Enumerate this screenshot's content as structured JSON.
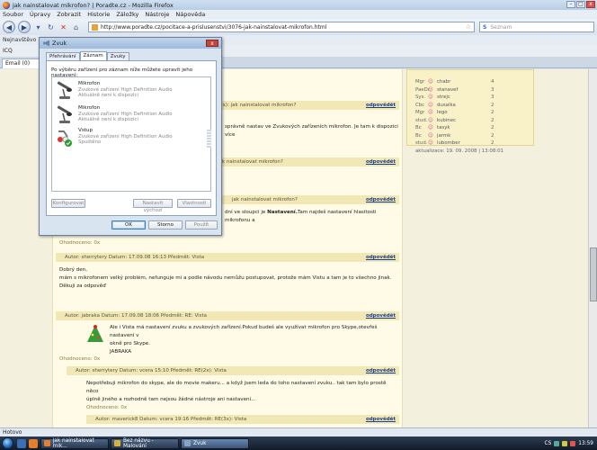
{
  "browser": {
    "title": "jak nainstalovat mikrofon? | Poradte.cz - Mozilla Firefox",
    "menu": [
      "Soubor",
      "Úpravy",
      "Zobrazit",
      "Historie",
      "Záložky",
      "Nástroje",
      "Nápověda"
    ],
    "url": "http://www.poradte.cz/pocitace-a-prislusenstvi/3076-jak-nainstalovat-mikrofon.html",
    "search_placeholder": "Seznam",
    "bookmark": "Nejnavštěvo",
    "toolbar_icq": "ICQ",
    "tab_label": "Email (0)",
    "status": "Hotovo"
  },
  "dialog": {
    "title": "Zvuk",
    "tabs": [
      "Přehrávání",
      "Záznam",
      "Zvuky"
    ],
    "active_tab": 1,
    "instruction": "Po výběru zařízení pro záznam níže můžete upravit jeho nastavení:",
    "devices": [
      {
        "name": "Mikrofon",
        "driver": "Zvukové zařízení High Definition Audio",
        "state": "Aktuálně není k dispozici"
      },
      {
        "name": "Mikrofon",
        "driver": "Zvukové zařízení High Definition Audio",
        "state": "Aktuálně není k dispozici"
      },
      {
        "name": "Vstup",
        "driver": "Zvukové zařízení High Definition Audio",
        "state": "Spuštěno"
      }
    ],
    "btn_configure": "Konfigurovat",
    "btn_default": "Nastavit výchozí",
    "btn_properties": "Vlastnosti",
    "btn_ok": "OK",
    "btn_cancel": "Storno",
    "btn_apply": "Použít"
  },
  "page": {
    "reply": "odpovědět",
    "h1": "(3x): jak nainstalovat mikrofon?",
    "t1": "správně nastav ve Zvukových zařízeních mikrofon. Je tam k dispozici více",
    "h2": "jak nainstalovat mikrofon?",
    "h3": "jak nainstalovat mikrofon?",
    "t3": "dní ve sloupci je",
    "t3b": "Nastavení.",
    "t3c": "Tam najdeš nastavení hlasitosti mikrofonu a",
    "rated1": "Ohodnoceno: 0x",
    "post1_header": "Autor: sherrytery   Datum: 17.09.08 16:13   Předmět: Vista",
    "post1_l1": "Dobrý den,",
    "post1_l2": "mám s mikrofonem velký problém, nefunguje mi a podle návodu nemůžu postupovat, protože mám Vistu a tam je to všechno jinak.",
    "post1_l3": "Děkuji za odpověď",
    "post2_header": "Autor: jabraka   Datum: 17.09.08 18:06   Předmět: RE: Vista",
    "post2_l1": "Ale i Vista má nastavení zvuku a zvukových zařízení.Pokud budeš ale využívat mikrofon pro Skype,otevřeš nastavení v",
    "post2_l2": "okně pro Skype.",
    "post2_sig": "JABRAKA",
    "rated2": "Ohodnoceno: 0x",
    "post3_header": "Autor: sherrytery   Datum: vcera 15:10   Předmět: RE(2x): Vista",
    "post3_l1": "Nepotřebuji mikrofon do skype, ale do movie makeru... a když jsem ledа do toho nastavení zvuku.. tak tam bylo prostě něco",
    "post3_l2": "úplně jiného a rozhodně tam nejsou žádné nástroje ani nastavení...",
    "rated3": "Ohodnoceno: 0x",
    "post4_header": "Autor: maverick8   Datum: vcera 19:16   Předmět: RE(3x): Vista"
  },
  "sidebar": {
    "rows": [
      {
        "rank": "Mgr",
        "name": "chabr",
        "n": "4"
      },
      {
        "rank": "PaeDr",
        "name": "stanavef",
        "n": "3"
      },
      {
        "rank": "Sys.",
        "name": "strejc",
        "n": "3"
      },
      {
        "rank": "Cbc",
        "name": "dusalka",
        "n": "2"
      },
      {
        "rank": "Mgr",
        "name": "lego",
        "n": "2"
      },
      {
        "rank": "stud.",
        "name": "kubinec",
        "n": "2"
      },
      {
        "rank": "Bc",
        "name": "tasyk",
        "n": "2"
      },
      {
        "rank": "Bc",
        "name": "jarmk",
        "n": "2"
      },
      {
        "rank": "stud.",
        "name": "lubomber",
        "n": "2"
      }
    ],
    "updated": "aktualizace: 19. 09. 2008 | 13:08:01"
  },
  "taskbar": {
    "items": [
      "jak nainstalovat mik...",
      "Bez názvu - Malování",
      "Zvuk"
    ],
    "lang": "CS",
    "clock": "13:59"
  }
}
